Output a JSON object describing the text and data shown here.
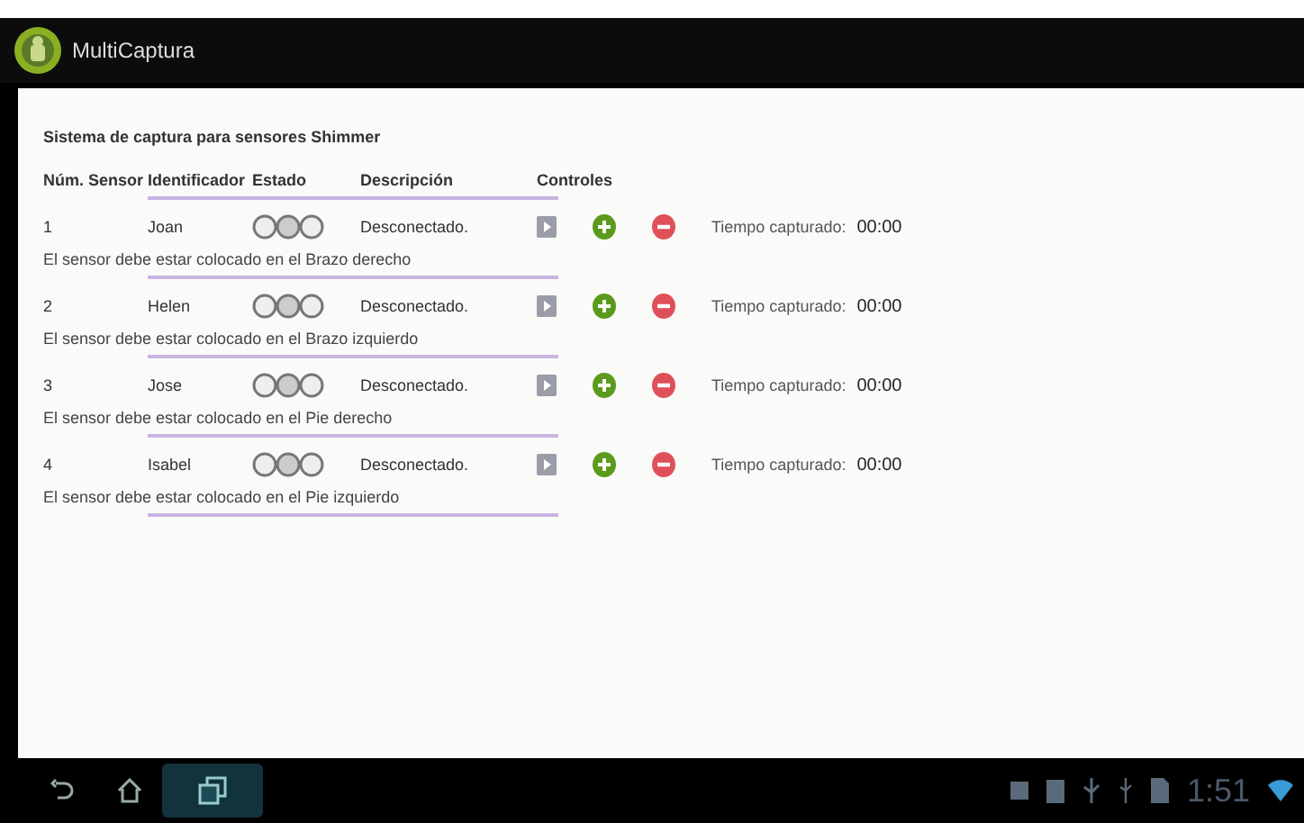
{
  "app_bar": {
    "title": "MultiCaptura"
  },
  "heading": "Sistema de captura para sensores Shimmer",
  "columns": [
    "Núm. Sensor",
    "Identificador",
    "Estado",
    "Descripción",
    "Controles"
  ],
  "sensors": [
    {
      "number": "1",
      "name": "Joan",
      "description": "Desconectado.",
      "time_label": "Tiempo capturado:",
      "time": "00:00",
      "note": "El sensor debe estar colocado en el Brazo derecho"
    },
    {
      "number": "2",
      "name": "Helen",
      "description": "Desconectado.",
      "time_label": "Tiempo capturado:",
      "time": "00:00",
      "note": "El sensor debe estar colocado en el Brazo izquierdo"
    },
    {
      "number": "3",
      "name": "Jose",
      "description": "Desconectado.",
      "time_label": "Tiempo capturado:",
      "time": "00:00",
      "note": "El sensor debe estar colocado en el Pie derecho"
    },
    {
      "number": "4",
      "name": "Isabel",
      "description": "Desconectado.",
      "time_label": "Tiempo capturado:",
      "time": "00:00",
      "note": "El sensor debe estar colocado en el Pie izquierdo"
    }
  ],
  "status_bar": {
    "clock": "1:51"
  }
}
